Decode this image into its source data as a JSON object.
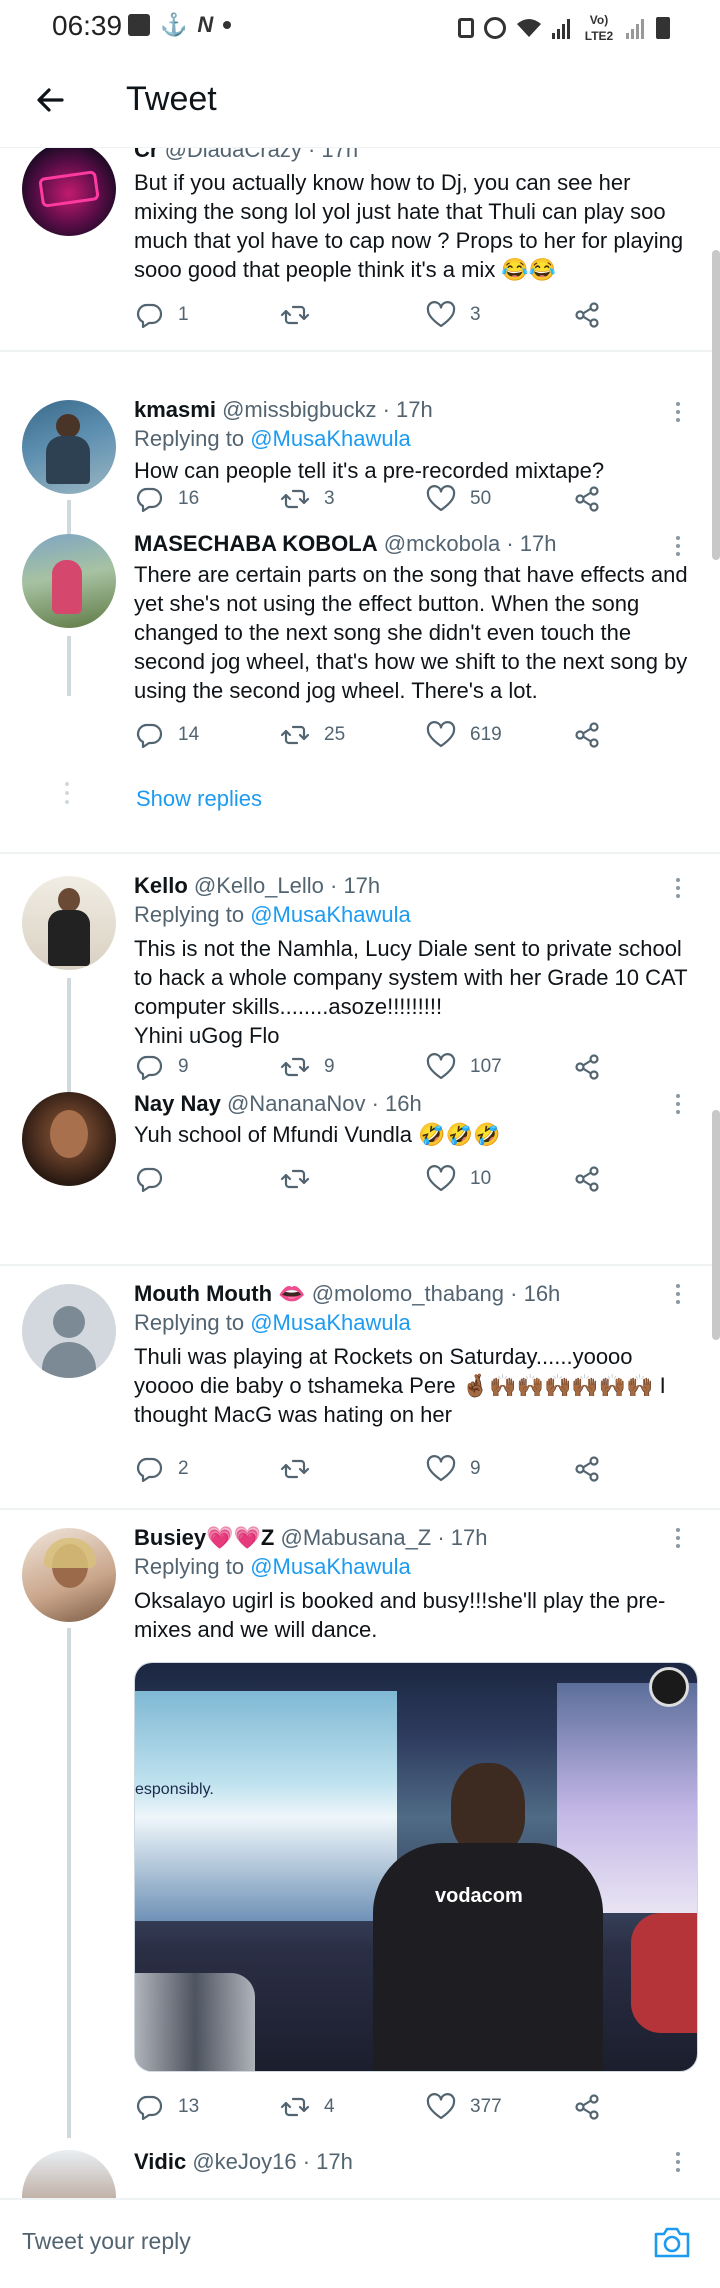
{
  "status_bar": {
    "time": "06:39",
    "network_label": "Vo) LTE2"
  },
  "header": {
    "title": "Tweet"
  },
  "tweets": [
    {
      "id": "t0",
      "name": "Cr",
      "handle": "@DiadaCrazy · 17h",
      "text": "But if you actually know how to Dj, you can see her mixing the song lol yol just hate that Thuli can play soo much that yol have to cap now ? Props to her for playing sooo good that people think it's a mix 😂😂",
      "replies": "1",
      "retweets": "",
      "likes": "3"
    },
    {
      "id": "t1",
      "name": "kmasmi",
      "handle": "@missbigbuckz · 17h",
      "replying_prefix": "Replying to ",
      "replying_to": "@MusaKhawula",
      "text": "How can people tell it's a pre-recorded mixtape?",
      "replies": "16",
      "retweets": "3",
      "likes": "50"
    },
    {
      "id": "t2",
      "name": "MASECHABA KOBOLA",
      "handle": "@mckobola · 17h",
      "text": "There are certain parts on the song that have effects and yet she's not using the effect button. When the song changed to the next song she didn't even touch the second jog wheel, that's how we shift to the next song by using the second jog wheel. There's a lot.",
      "replies": "14",
      "retweets": "25",
      "likes": "619"
    },
    {
      "id": "t3",
      "name": "Kello",
      "handle": "@Kello_Lello · 17h",
      "replying_prefix": "Replying to ",
      "replying_to": "@MusaKhawula",
      "text": "This is not the Namhla, Lucy Diale sent to private school to hack a whole company system with her Grade 10 CAT computer skills........asoze!!!!!!!!!\nYhini uGog Flo",
      "replies": "9",
      "retweets": "9",
      "likes": "107"
    },
    {
      "id": "t4",
      "name": "Nay Nay",
      "handle": "@NananaNov · 16h",
      "text": "Yuh school of Mfundi Vundla 🤣🤣🤣",
      "replies": "",
      "retweets": "",
      "likes": "10"
    },
    {
      "id": "t5",
      "name": "Mouth Mouth 👄",
      "handle": "@molomo_thabang · 16h",
      "replying_prefix": "Replying to ",
      "replying_to": "@MusaKhawula",
      "text": "Thuli was playing at Rockets on Saturday......yoooo yoooo die baby o tshameka Pere 🤞🏾🙌🏾🙌🏾🙌🏾🙌🏾🙌🏾🙌🏾 I thought MacG was hating on her",
      "replies": "2",
      "retweets": "",
      "likes": "9"
    },
    {
      "id": "t6",
      "name": "Busiey💗💗Z",
      "handle": "@Mabusana_Z · 17h",
      "replying_prefix": "Replying to ",
      "replying_to": "@MusaKhawula",
      "text": "Oksalayo ugirl is booked and busy!!!she'll play the pre-mixes and we will dance.",
      "media_caption_left": "esponsibly.",
      "media_shirt_text": "vodacom",
      "replies": "13",
      "retweets": "4",
      "likes": "377"
    },
    {
      "id": "t7",
      "name": "Vidic",
      "handle": "@keJoy16 · 17h"
    }
  ],
  "show_replies_label": "Show replies",
  "composer": {
    "placeholder": "Tweet your reply"
  },
  "colors": {
    "accent": "#1d9bf0",
    "text_secondary": "#536471",
    "divider": "#eff3f4"
  }
}
